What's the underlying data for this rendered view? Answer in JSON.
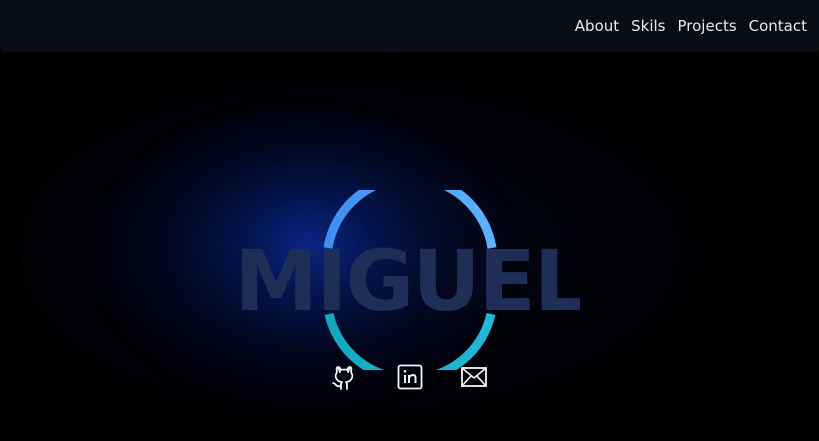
{
  "nav": {
    "items": [
      {
        "label": "About"
      },
      {
        "label": "Skils"
      },
      {
        "label": "Projects"
      },
      {
        "label": "Contact"
      }
    ]
  },
  "hero": {
    "logo_text": "MIGUEL",
    "colors": {
      "ring_top": "#4aa3ff",
      "ring_bottom": "#19b6cc",
      "letters": "#1f2e57",
      "glow": "#0b2a8c"
    }
  },
  "socials": [
    {
      "icon": "github-icon"
    },
    {
      "icon": "linkedin-icon"
    },
    {
      "icon": "mail-icon"
    }
  ]
}
